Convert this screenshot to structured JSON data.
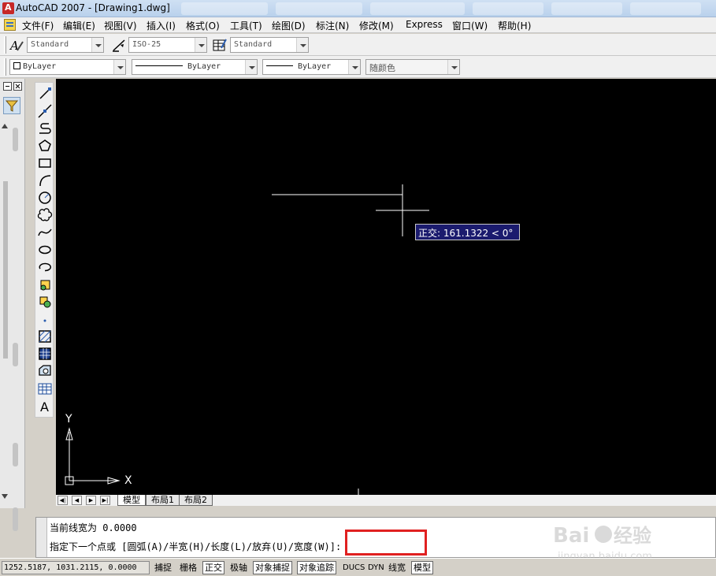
{
  "window": {
    "title": "AutoCAD 2007 - [Drawing1.dwg]"
  },
  "menu": [
    "文件(F)",
    "编辑(E)",
    "视图(V)",
    "插入(I)",
    "格式(O)",
    "工具(T)",
    "绘图(D)",
    "标注(N)",
    "修改(M)",
    "Express",
    "窗口(W)",
    "帮助(H)"
  ],
  "styles_toolbar": {
    "text_style": "Standard",
    "dim_style": "ISO-25",
    "table_style": "Standard"
  },
  "properties_toolbar": {
    "layer": "ByLayer",
    "linetype": "ByLayer",
    "lineweight": "ByLayer",
    "plot_style": "随颜色"
  },
  "canvas": {
    "tooltip": "正交: 161.1322 < 0°",
    "ucs_x": "X",
    "ucs_y": "Y"
  },
  "layout_tabs": [
    "模型",
    "布局1",
    "布局2"
  ],
  "command_line": {
    "line1": "当前线宽为 0.0000",
    "line2_prefix": "指定下一个点或 [圆弧(A)/半宽(H)/长度(L)/放弃(U)/",
    "line2_highlight": "宽度(W)]:"
  },
  "status_bar": {
    "coordinates": "1252.5187, 1031.2115, 0.0000",
    "buttons": [
      {
        "label": "捕捉",
        "on": false
      },
      {
        "label": "栅格",
        "on": false
      },
      {
        "label": "正交",
        "on": true
      },
      {
        "label": "极轴",
        "on": false
      },
      {
        "label": "对象捕捉",
        "on": true
      },
      {
        "label": "对象追踪",
        "on": true
      },
      {
        "label": "DUCS",
        "on": false
      },
      {
        "label": "DYN",
        "on": false
      },
      {
        "label": "线宽",
        "on": false
      },
      {
        "label": "模型",
        "on": true
      }
    ]
  },
  "watermark": {
    "brand": "Baidu",
    "cn": "经验",
    "url": "jingyan.baidu.com"
  },
  "colors": {
    "canvas_bg": "#000000",
    "tooltip_bg": "#1b1b6e",
    "highlight": "#e02020"
  }
}
